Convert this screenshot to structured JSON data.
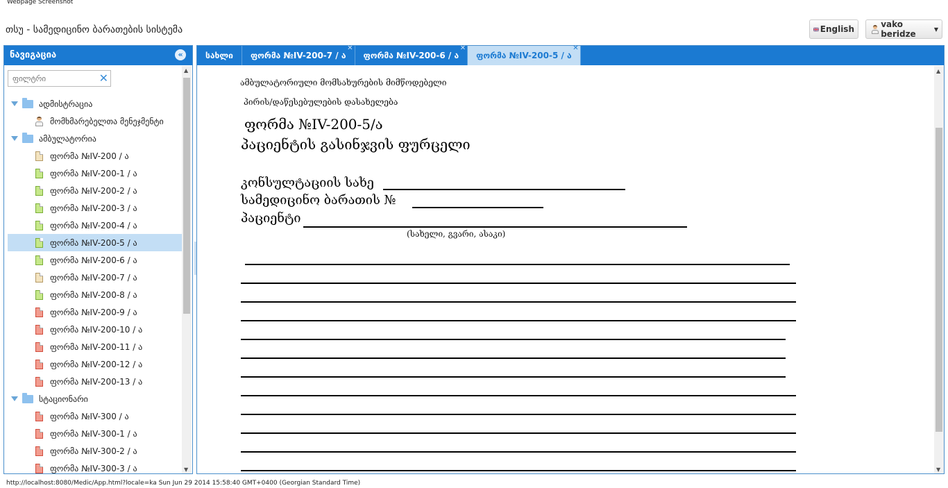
{
  "print_header": "Webpage Screenshot",
  "app": {
    "title": "თსუ - სამედიცინო ბარათების სისტემა",
    "language_button": "English",
    "user_button": "vako beridze"
  },
  "sidebar": {
    "title": "ნავიგაცია",
    "filter_placeholder": "ფილტრი",
    "tree": [
      {
        "label": "ადმისტრაცია",
        "type": "folder"
      },
      {
        "label": "მომხმარებელთა მენეჯმენტი",
        "type": "person"
      },
      {
        "label": "ამბულატორია",
        "type": "folder"
      },
      {
        "label": "ფორმა №IV-200 / ა",
        "type": "doc",
        "color": "beige"
      },
      {
        "label": "ფორმა №IV-200-1 / ა",
        "type": "doc",
        "color": "green"
      },
      {
        "label": "ფორმა №IV-200-2 / ა",
        "type": "doc",
        "color": "green"
      },
      {
        "label": "ფორმა №IV-200-3 / ა",
        "type": "doc",
        "color": "green"
      },
      {
        "label": "ფორმა №IV-200-4 / ა",
        "type": "doc",
        "color": "green"
      },
      {
        "label": "ფორმა №IV-200-5 / ა",
        "type": "doc",
        "color": "green",
        "selected": true
      },
      {
        "label": "ფორმა №IV-200-6 / ა",
        "type": "doc",
        "color": "green"
      },
      {
        "label": "ფორმა №IV-200-7 / ა",
        "type": "doc",
        "color": "beige"
      },
      {
        "label": "ფორმა №IV-200-8 / ა",
        "type": "doc",
        "color": "green"
      },
      {
        "label": "ფორმა №IV-200-9 / ა",
        "type": "doc",
        "color": "red"
      },
      {
        "label": "ფორმა №IV-200-10 / ა",
        "type": "doc",
        "color": "red"
      },
      {
        "label": "ფორმა №IV-200-11 / ა",
        "type": "doc",
        "color": "red"
      },
      {
        "label": "ფორმა №IV-200-12 / ა",
        "type": "doc",
        "color": "red"
      },
      {
        "label": "ფორმა №IV-200-13 / ა",
        "type": "doc",
        "color": "red"
      },
      {
        "label": "სტაციონარი",
        "type": "folder"
      },
      {
        "label": "ფორმა №IV-300 / ა",
        "type": "doc",
        "color": "red"
      },
      {
        "label": "ფორმა №IV-300-1 / ა",
        "type": "doc",
        "color": "red"
      },
      {
        "label": "ფორმა №IV-300-2 / ა",
        "type": "doc",
        "color": "red"
      },
      {
        "label": "ფორმა №IV-300-3 / ა",
        "type": "doc",
        "color": "red"
      }
    ]
  },
  "tabs": [
    {
      "label": "სახლი",
      "closable": false,
      "active": false
    },
    {
      "label": "ფორმა №IV-200-7 / ა",
      "closable": true,
      "active": false
    },
    {
      "label": "ფორმა №IV-200-6 / ა",
      "closable": true,
      "active": false
    },
    {
      "label": "ფორმა №IV-200-5 / ა",
      "closable": true,
      "active": true
    }
  ],
  "form": {
    "provider_line1": "ამბულატორიული მომსახურების მიმწოდებელი",
    "provider_line2": "პირის/დაწესებულების დასახელება",
    "form_number": "ფორმა №IV-200-5/ა",
    "form_title": "პაციენტის გასინჯვის ფურცელი",
    "consultation_label": "კონსულტაციის სახე",
    "card_label": "სამედიცინო ბარათის №",
    "patient_label": "პაციენტი",
    "patient_hint": "(სახელი, გვარი, ასაკი)"
  },
  "status_bar": "http://localhost:8080/Medic/App.html?locale=ka Sun Jun 29 2014 15:58:40 GMT+0400 (Georgian Standard Time)",
  "colors": {
    "accent": "#1b7ad2",
    "selected": "#c3def5"
  }
}
